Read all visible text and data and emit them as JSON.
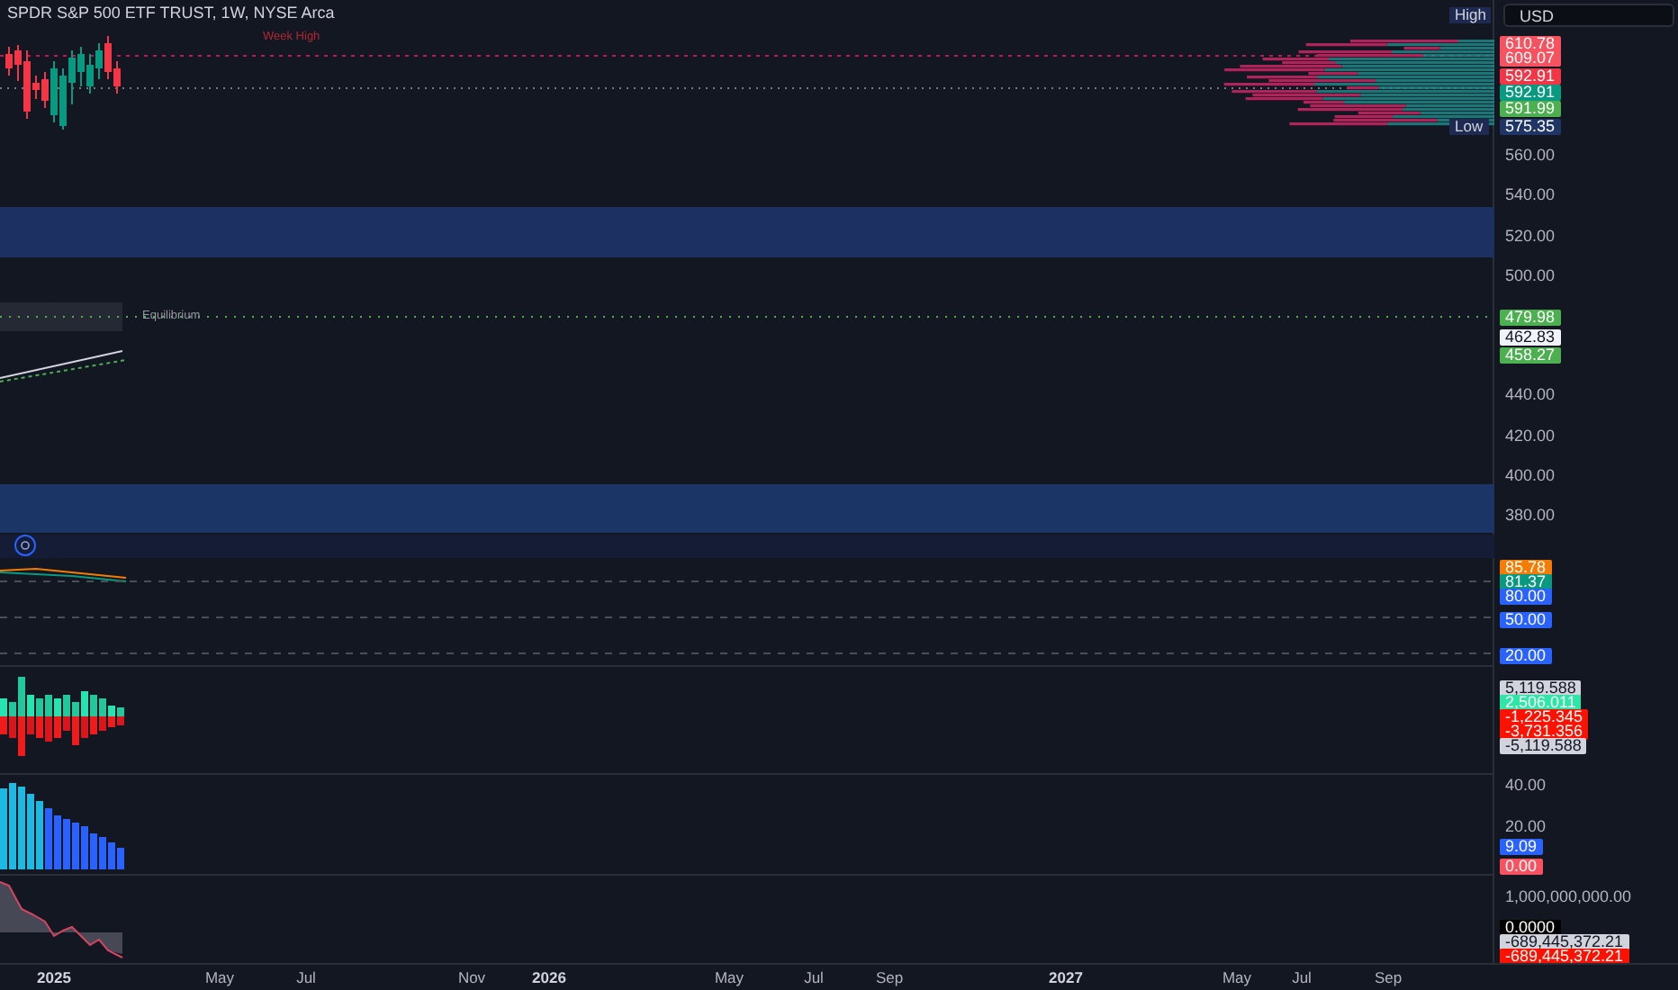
{
  "header": {
    "title": "SPDR S&P 500 ETF TRUST, 1W, NYSE Arca",
    "currency": "USD"
  },
  "badges": [
    {
      "kind": "high",
      "label": "High"
    },
    {
      "kind": "low",
      "label": "Low"
    }
  ],
  "chart_labels": [
    {
      "kind": "week-high",
      "text": "Week High"
    },
    {
      "kind": "equilibrium",
      "text": "Equilibrium"
    }
  ],
  "panes": [
    {
      "axis_labels": [
        {
          "text": "610.78",
          "kind": "tag",
          "color": "#f7525f"
        },
        {
          "text": "609.07",
          "kind": "tag",
          "color": "#f7525f"
        },
        {
          "text": "592.91",
          "kind": "tag",
          "color": "#f23645"
        },
        {
          "text": "592.91",
          "kind": "tag",
          "color": "#089981"
        },
        {
          "text": "591.99",
          "kind": "tag",
          "color": "#4caf50"
        },
        {
          "text": "575.35",
          "kind": "tag",
          "color": "#1e3566"
        },
        {
          "text": "560.00",
          "kind": "plain"
        },
        {
          "text": "540.00",
          "kind": "plain"
        },
        {
          "text": "520.00",
          "kind": "plain"
        },
        {
          "text": "500.00",
          "kind": "plain"
        },
        {
          "text": "479.98",
          "kind": "tag",
          "color": "#4caf50"
        },
        {
          "text": "462.83",
          "kind": "tag",
          "color": "#f0f3fa"
        },
        {
          "text": "458.27",
          "kind": "tag",
          "color": "#4caf50"
        },
        {
          "text": "440.00",
          "kind": "plain"
        },
        {
          "text": "420.00",
          "kind": "plain"
        },
        {
          "text": "400.00",
          "kind": "plain"
        },
        {
          "text": "380.00",
          "kind": "plain"
        }
      ]
    },
    {
      "axis_labels": [
        {
          "text": "85.78",
          "kind": "tag",
          "color": "#f57c00"
        },
        {
          "text": "81.37",
          "kind": "tag",
          "color": "#089981"
        },
        {
          "text": "80.00",
          "kind": "tag",
          "color": "#2962ff"
        },
        {
          "text": "50.00",
          "kind": "tag",
          "color": "#2962ff"
        },
        {
          "text": "20.00",
          "kind": "tag",
          "color": "#2962ff"
        }
      ]
    },
    {
      "axis_labels": [
        {
          "text": "5,119.588",
          "kind": "tag",
          "color": "#d1d4dc"
        },
        {
          "text": "2,506.011",
          "kind": "tag",
          "color": "#2ee6a6"
        },
        {
          "text": "-1,225.345",
          "kind": "tag",
          "color": "#ff1100"
        },
        {
          "text": "-3,731.356",
          "kind": "tag",
          "color": "#ff1100"
        },
        {
          "text": "-5,119.588",
          "kind": "tag",
          "color": "#d1d4dc"
        }
      ]
    },
    {
      "axis_labels": [
        {
          "text": "40.00",
          "kind": "plain"
        },
        {
          "text": "20.00",
          "kind": "plain"
        },
        {
          "text": "9.09",
          "kind": "tag",
          "color": "#2962ff"
        },
        {
          "text": "0.00",
          "kind": "tag",
          "color": "#f7525f"
        }
      ]
    },
    {
      "axis_labels": [
        {
          "text": "1,000,000,000.00",
          "kind": "plain"
        },
        {
          "text": "0.0000",
          "kind": "tag",
          "color": "#000000"
        },
        {
          "text": "-689,445,372.21",
          "kind": "tag",
          "color": "#d1d4dc"
        },
        {
          "text": "-689,445,372.21",
          "kind": "tag",
          "color": "#ff1100"
        }
      ]
    }
  ],
  "time_axis": [
    {
      "text": "2025",
      "kind": "year"
    },
    {
      "text": "May",
      "kind": "month"
    },
    {
      "text": "Jul",
      "kind": "month"
    },
    {
      "text": "Nov",
      "kind": "month"
    },
    {
      "text": "2026",
      "kind": "year"
    },
    {
      "text": "May",
      "kind": "month"
    },
    {
      "text": "Jul",
      "kind": "month"
    },
    {
      "text": "Sep",
      "kind": "month"
    },
    {
      "text": "2027",
      "kind": "year"
    },
    {
      "text": "May",
      "kind": "month"
    },
    {
      "text": "Jul",
      "kind": "month"
    },
    {
      "text": "Sep",
      "kind": "month"
    }
  ]
}
